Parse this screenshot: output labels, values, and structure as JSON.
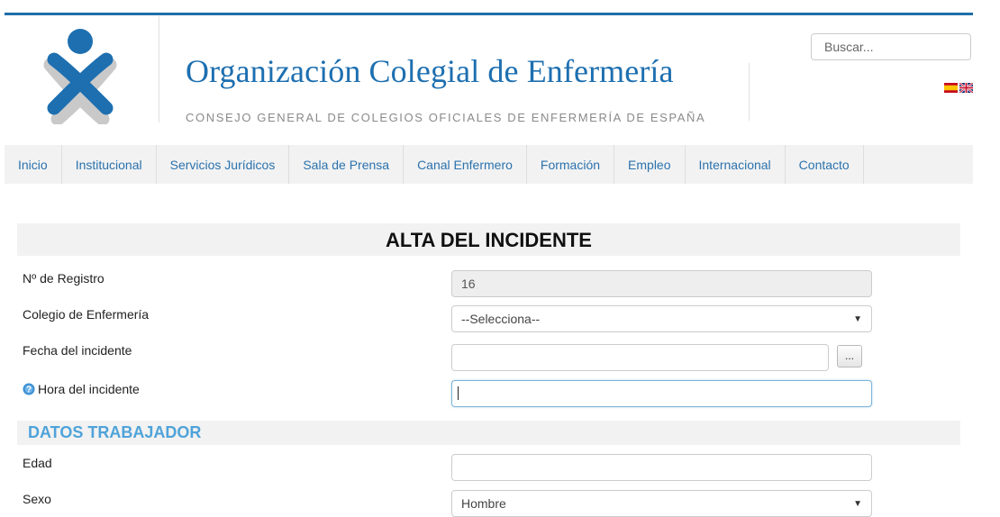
{
  "header": {
    "title": "Organización Colegial de Enfermería",
    "subtitle": "CONSEJO GENERAL DE COLEGIOS OFICIALES DE ENFERMERÍA DE ESPAÑA",
    "search_placeholder": "Buscar...",
    "logo_icon": "nurse-cross-logo",
    "languages": [
      "es-flag-icon",
      "uk-flag-icon"
    ],
    "brand_color": "#1d6fb0"
  },
  "nav": {
    "items": [
      "Inicio",
      "Institucional",
      "Servicios Jurídicos",
      "Sala de Prensa",
      "Canal Enfermero",
      "Formación",
      "Empleo",
      "Internacional",
      "Contacto"
    ]
  },
  "form": {
    "title": "ALTA DEL INCIDENTE",
    "registro": {
      "label": "Nº de Registro",
      "value": "16"
    },
    "colegio": {
      "label": "Colegio de Enfermería",
      "value": "--Selecciona--"
    },
    "fecha": {
      "label": "Fecha del incidente",
      "value": "",
      "button_label": "..."
    },
    "hora": {
      "label": "Hora del incidente",
      "value": "",
      "icon": "help-icon"
    },
    "section_trabajador": "DATOS TRABAJADOR",
    "edad": {
      "label": "Edad",
      "value": ""
    },
    "sexo": {
      "label": "Sexo",
      "value": "Hombre"
    }
  }
}
